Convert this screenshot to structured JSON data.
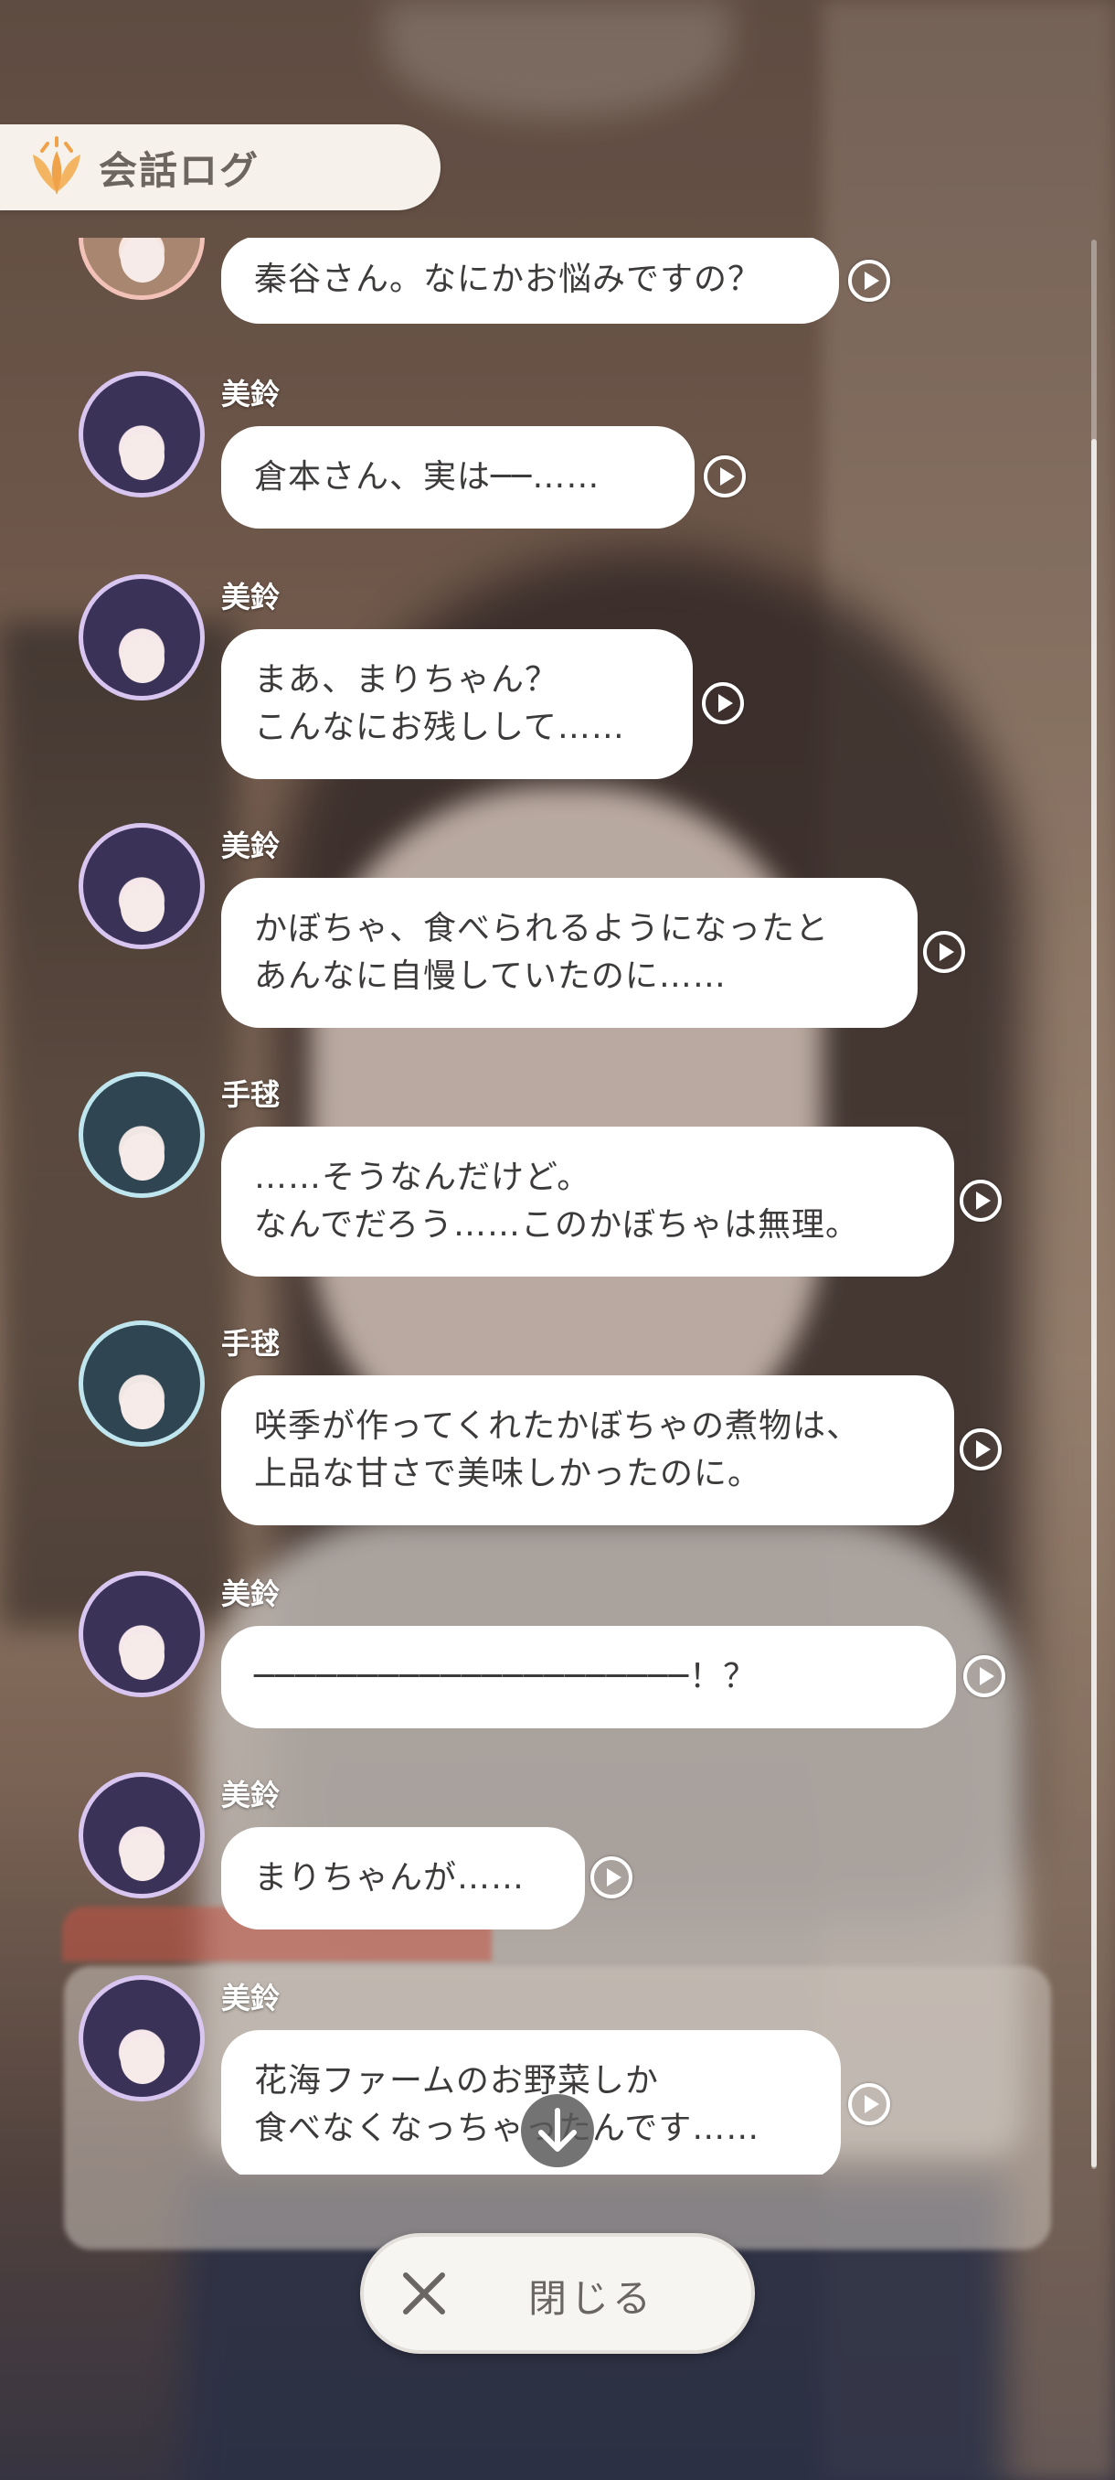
{
  "header": {
    "title": "会話ログ",
    "icon": "leaf-logo-icon"
  },
  "entries": [
    {
      "speaker": "",
      "avatar": "saki",
      "lines": [
        "秦谷さん。なにかお悩みですの？"
      ]
    },
    {
      "speaker": "美鈴",
      "avatar": "misuzu",
      "lines": [
        "倉本さん、実は──……"
      ]
    },
    {
      "speaker": "美鈴",
      "avatar": "misuzu",
      "lines": [
        "まあ、まりちゃん？",
        "こんなにお残しして……"
      ]
    },
    {
      "speaker": "美鈴",
      "avatar": "misuzu",
      "lines": [
        "かぼちゃ、食べられるようになったと",
        "あんなに自慢していたのに……"
      ]
    },
    {
      "speaker": "手毬",
      "avatar": "temari",
      "lines": [
        "……そうなんだけど。",
        "なんでだろう……このかぼちゃは無理。"
      ]
    },
    {
      "speaker": "手毬",
      "avatar": "temari",
      "lines": [
        "咲季が作ってくれたかぼちゃの煮物は、",
        "上品な甘さで美味しかったのに。"
      ]
    },
    {
      "speaker": "美鈴",
      "avatar": "misuzu",
      "lines": [
        "─────────────────────！？"
      ]
    },
    {
      "speaker": "美鈴",
      "avatar": "misuzu",
      "lines": [
        "まりちゃんが……"
      ]
    },
    {
      "speaker": "美鈴",
      "avatar": "misuzu",
      "lines": [
        "花海ファームのお野菜しか",
        "食べなくなっちゃったんです……"
      ]
    }
  ],
  "close_button": {
    "label": "閉じる",
    "icon": "close-icon"
  },
  "scroll_down": {
    "icon": "arrow-down-icon"
  },
  "colors": {
    "bubble": "#ffffff",
    "header_bg": "#f6f1ea",
    "logo_orange": "#f0a24a"
  }
}
